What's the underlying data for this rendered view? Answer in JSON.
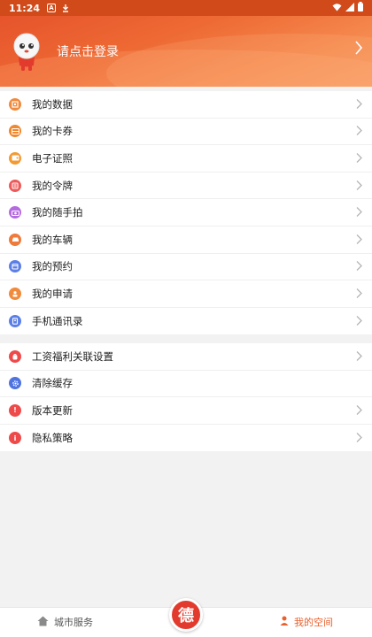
{
  "status_bar": {
    "time": "11:24"
  },
  "profile": {
    "login_prompt": "请点击登录"
  },
  "menu_group_1": [
    {
      "label": "我的数据",
      "icon": "data-icon",
      "color": "#f08a3c"
    },
    {
      "label": "我的卡券",
      "icon": "coupon-icon",
      "color": "#f0882e"
    },
    {
      "label": "电子证照",
      "icon": "wallet-icon",
      "color": "#f39a33"
    },
    {
      "label": "我的令牌",
      "icon": "token-icon",
      "color": "#ee5a5a"
    },
    {
      "label": "我的随手拍",
      "icon": "camera-icon",
      "color": "#b56be0"
    },
    {
      "label": "我的车辆",
      "icon": "car-icon",
      "color": "#f07a3a"
    },
    {
      "label": "我的预约",
      "icon": "calendar-icon",
      "color": "#5b7fe6"
    },
    {
      "label": "我的申请",
      "icon": "apply-icon",
      "color": "#f08a3c"
    },
    {
      "label": "手机通讯录",
      "icon": "contacts-icon",
      "color": "#5b7fe6"
    }
  ],
  "menu_group_2": [
    {
      "label": "工资福利关联设置",
      "icon": "bag-icon",
      "color": "#ee4a4a"
    },
    {
      "label": "清除缓存",
      "icon": "gear-icon",
      "color": "#4f74e0"
    },
    {
      "label": "版本更新",
      "icon": "alert-icon",
      "color": "#ee4a4a"
    },
    {
      "label": "隐私策略",
      "icon": "info-icon",
      "color": "#ee4a4a"
    }
  ],
  "bottom_nav": {
    "left_label": "城市服务",
    "center_glyph": "德",
    "right_label": "我的空间"
  }
}
